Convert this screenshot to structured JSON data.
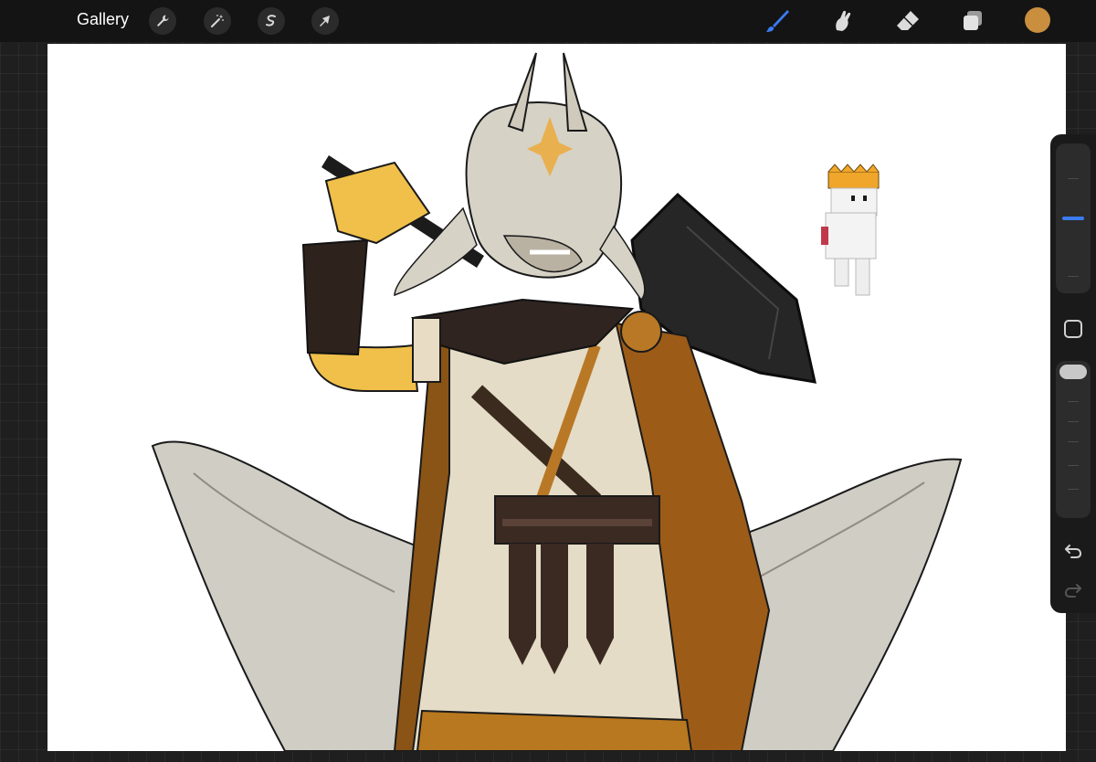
{
  "topbar": {
    "gallery_label": "Gallery",
    "left_tools": [
      {
        "icon": "wrench-icon"
      },
      {
        "icon": "magic-wand-icon"
      },
      {
        "icon": "selection-icon"
      },
      {
        "icon": "transform-arrow-icon"
      }
    ],
    "right_tools": [
      {
        "icon": "brush-icon",
        "active": true
      },
      {
        "icon": "smudge-icon"
      },
      {
        "icon": "eraser-icon"
      },
      {
        "icon": "layers-icon"
      }
    ],
    "current_color": "#c98e3e"
  },
  "sidebar": {
    "brush_size_level": 0.5,
    "opacity_level": 0.0,
    "icons": [
      "modify-square-icon",
      "undo-icon",
      "redo-icon"
    ]
  },
  "colors": {
    "accent": "#3a7bf0",
    "gold": "#c98e3e",
    "canvas": "#ffffff"
  }
}
